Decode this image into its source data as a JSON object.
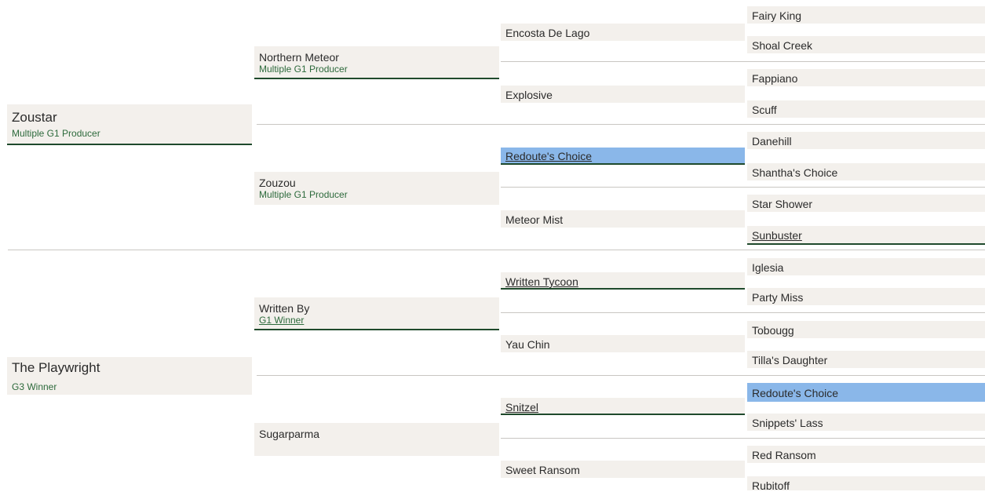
{
  "gen1": [
    {
      "name": "Zoustar",
      "note": "Multiple G1 Producer"
    },
    {
      "name": "The Playwright",
      "note": "G3 Winner"
    }
  ],
  "gen2": [
    {
      "name": "Northern Meteor",
      "note": "Multiple G1 Producer"
    },
    {
      "name": "Zouzou",
      "note": "Multiple G1 Producer"
    },
    {
      "name": "Written By",
      "note": "G1 Winner"
    },
    {
      "name": "Sugarparma",
      "note": ""
    }
  ],
  "gen3": [
    {
      "name": "Encosta De Lago"
    },
    {
      "name": "Explosive"
    },
    {
      "name": "Redoute's Choice"
    },
    {
      "name": "Meteor Mist"
    },
    {
      "name": "Written Tycoon"
    },
    {
      "name": "Yau Chin"
    },
    {
      "name": "Snitzel"
    },
    {
      "name": "Sweet Ransom"
    }
  ],
  "gen4": [
    {
      "name": "Fairy King"
    },
    {
      "name": "Shoal Creek"
    },
    {
      "name": "Fappiano"
    },
    {
      "name": "Scuff"
    },
    {
      "name": "Danehill"
    },
    {
      "name": "Shantha's Choice"
    },
    {
      "name": "Star Shower"
    },
    {
      "name": "Sunbuster"
    },
    {
      "name": "Iglesia"
    },
    {
      "name": "Party Miss"
    },
    {
      "name": "Tobougg"
    },
    {
      "name": "Tilla's Daughter"
    },
    {
      "name": "Redoute's Choice"
    },
    {
      "name": "Snippets' Lass"
    },
    {
      "name": "Red Ransom"
    },
    {
      "name": "Rubitoff"
    }
  ],
  "colors": {
    "cell": "#f3f0ec",
    "highlight": "#8ab7e9",
    "accent": "#2d6a3c",
    "underline": "#1f4a2c"
  }
}
